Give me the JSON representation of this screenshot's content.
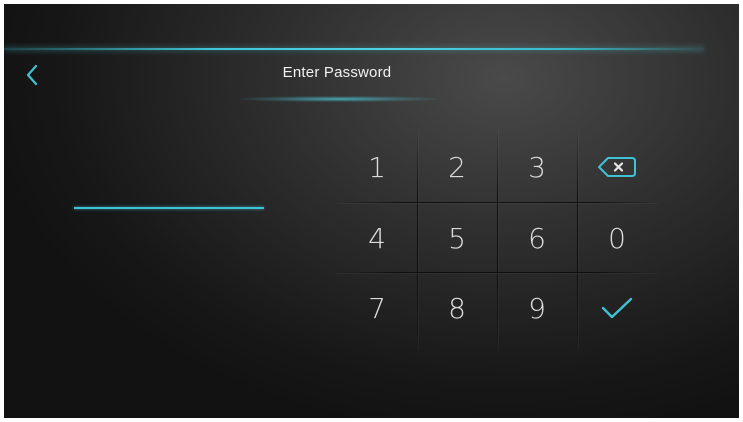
{
  "header": {
    "title": "Enter Password",
    "back_icon": "chevron-left-icon"
  },
  "password_field": {
    "value": ""
  },
  "keypad": {
    "keys": [
      {
        "label": "1",
        "type": "digit"
      },
      {
        "label": "2",
        "type": "digit"
      },
      {
        "label": "3",
        "type": "digit"
      },
      {
        "label": "",
        "type": "backspace",
        "icon": "backspace-icon"
      },
      {
        "label": "4",
        "type": "digit"
      },
      {
        "label": "5",
        "type": "digit"
      },
      {
        "label": "6",
        "type": "digit"
      },
      {
        "label": "0",
        "type": "digit"
      },
      {
        "label": "7",
        "type": "digit"
      },
      {
        "label": "8",
        "type": "digit"
      },
      {
        "label": "9",
        "type": "digit"
      },
      {
        "label": "",
        "type": "confirm",
        "icon": "checkmark-icon"
      }
    ]
  },
  "colors": {
    "accent": "#3fc2d4",
    "text": "#dcdcdc",
    "background": "#2e2e2e"
  }
}
